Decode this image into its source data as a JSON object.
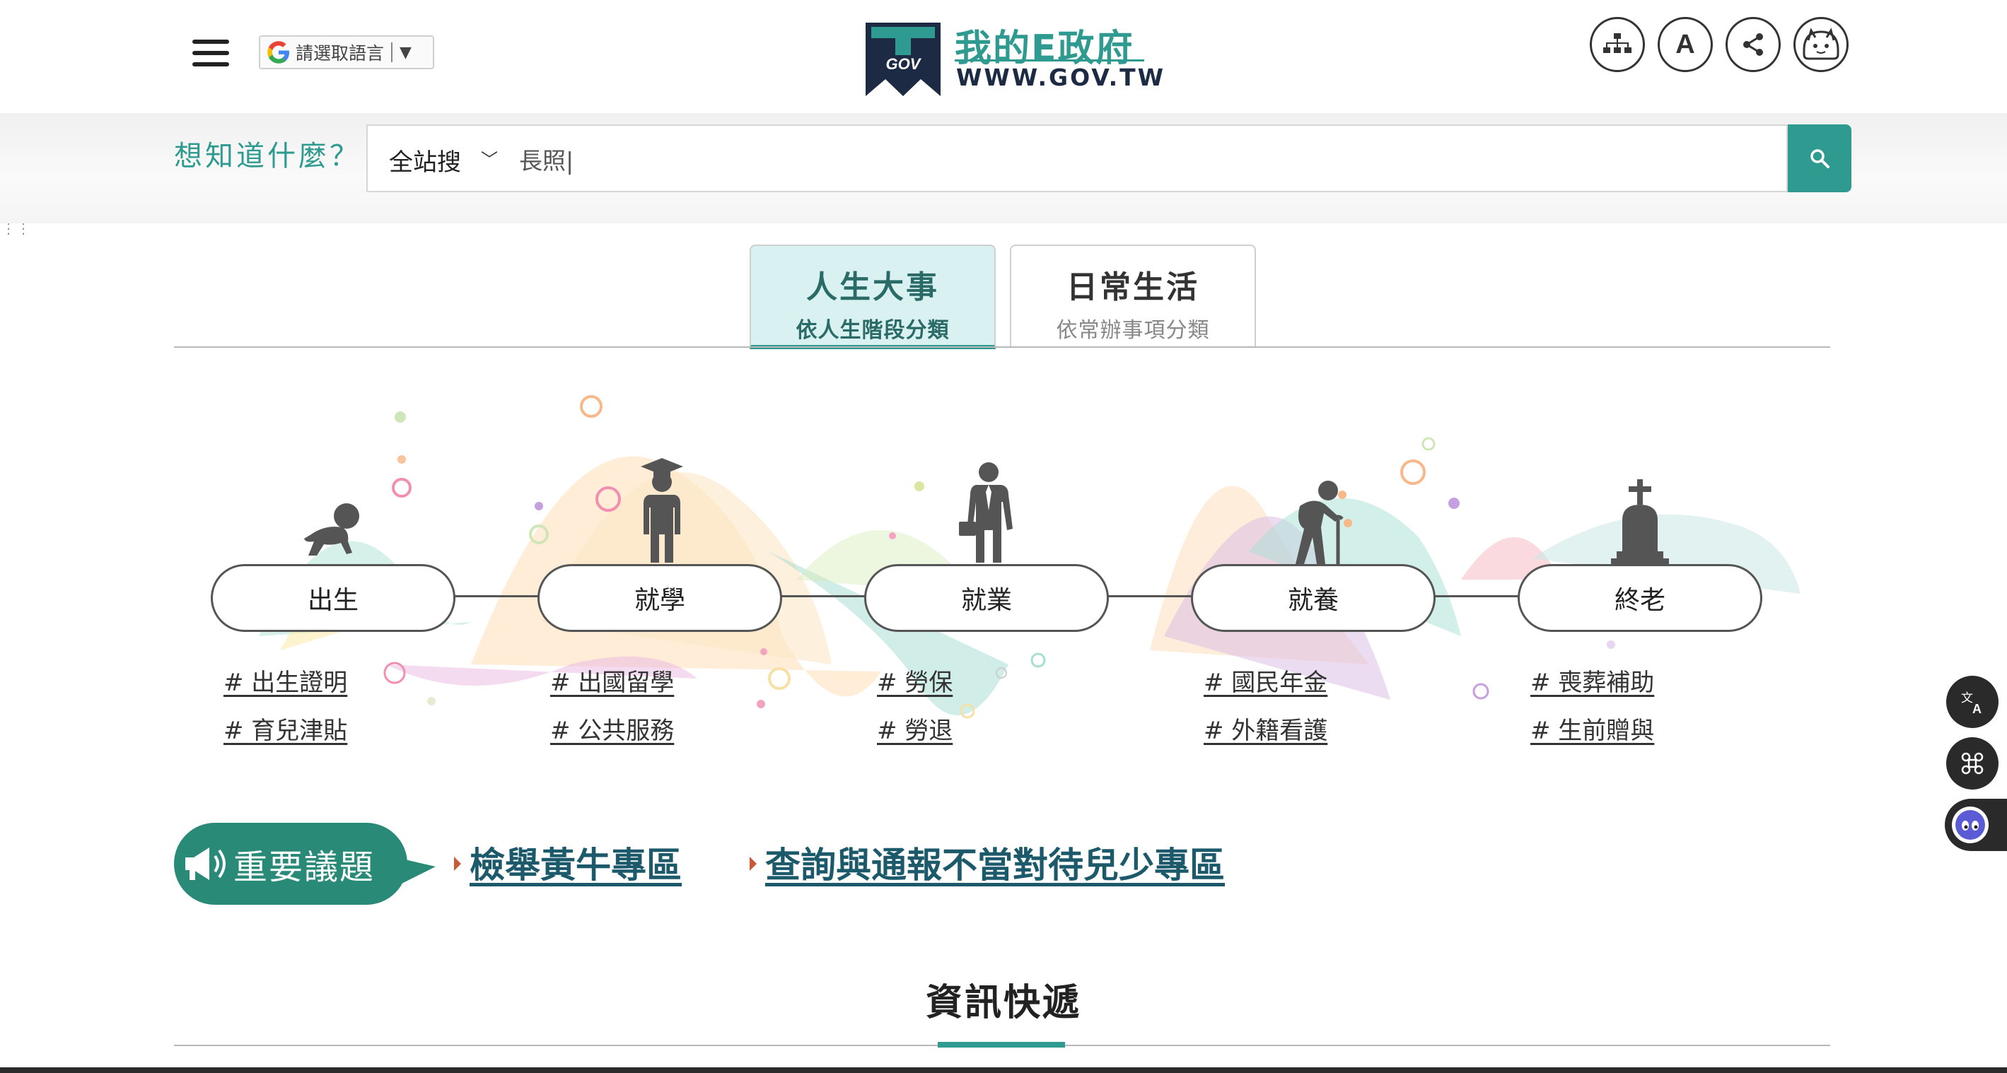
{
  "header": {
    "translate_label": "請選取語言",
    "translate_arrow": "▼",
    "logo_title": "我的E政府",
    "logo_url": "WWW.GOV.TW",
    "logo_badge": "GOV",
    "font_button_label": "A"
  },
  "search": {
    "prompt": "想知道什麼？",
    "scope": "全站搜",
    "query": "長照|"
  },
  "tabs": [
    {
      "title": "人生大事",
      "subtitle": "依人生階段分類",
      "active": true
    },
    {
      "title": "日常生活",
      "subtitle": "依常辦事項分類",
      "active": false
    }
  ],
  "stages": [
    {
      "label": "出生",
      "icon": "baby-crawling-icon",
      "tags": [
        "# 出生證明",
        "# 育兒津貼"
      ]
    },
    {
      "label": "就學",
      "icon": "graduate-icon",
      "tags": [
        "# 出國留學",
        "# 公共服務"
      ]
    },
    {
      "label": "就業",
      "icon": "businessman-icon",
      "tags": [
        "# 勞保",
        "# 勞退"
      ]
    },
    {
      "label": "就養",
      "icon": "elderly-cane-icon",
      "tags": [
        "# 國民年金",
        "# 外籍看護"
      ]
    },
    {
      "label": "終老",
      "icon": "tombstone-cross-icon",
      "tags": [
        "# 喪葬補助",
        "# 生前贈與"
      ]
    }
  ],
  "important": {
    "badge": "重要議題",
    "links": [
      "檢舉黃牛專區",
      "查詢與通報不當對待兒少專區"
    ]
  },
  "news": {
    "title": "資訊快遞"
  },
  "colors": {
    "brand_teal": "#2f9a8f",
    "topic_green": "#2a8a78",
    "link_blue": "#1c5a6b",
    "tab_active_bg": "#d9f1f0"
  }
}
